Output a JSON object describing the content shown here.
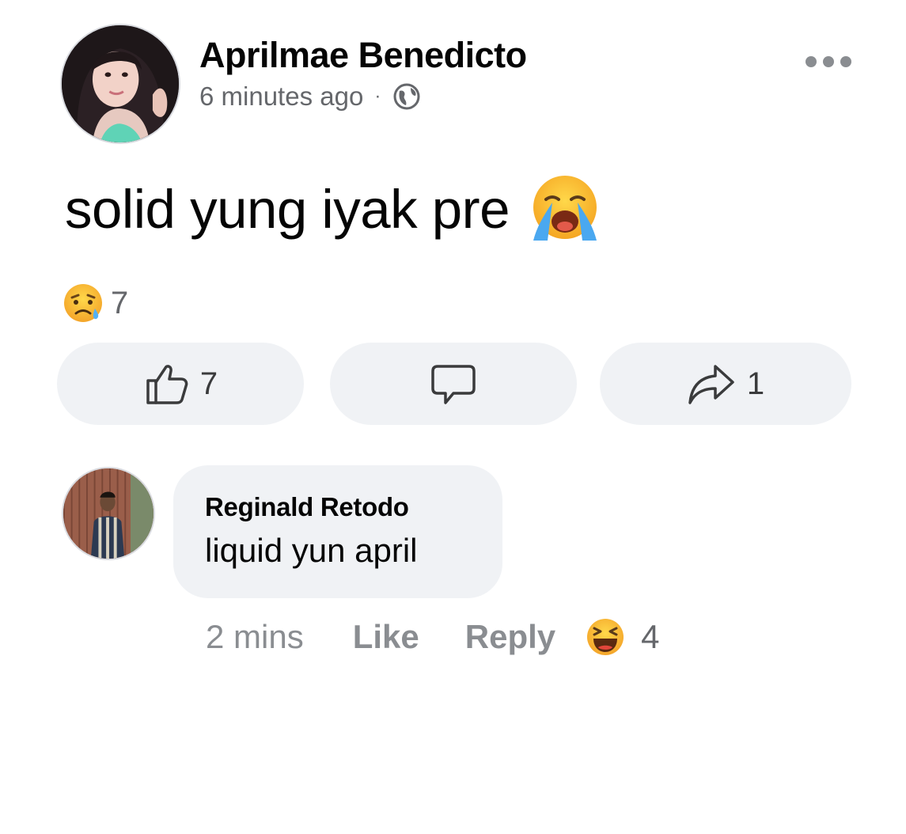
{
  "post": {
    "author": "Aprilmae Benedicto",
    "timestamp": "6 minutes ago",
    "separator": "·",
    "privacy_icon": "globe-icon",
    "text": "solid yung iyak pre",
    "text_emoji": "loudly-crying-face-emoji",
    "reactions": {
      "icon": "sad-but-relieved-face-emoji",
      "count": "7"
    }
  },
  "actions": {
    "like_count": "7",
    "share_count": "1"
  },
  "comment": {
    "author": "Reginald Retodo",
    "text": "liquid yun april",
    "time": "2 mins",
    "like_label": "Like",
    "reply_label": "Reply",
    "reaction_icon": "laughing-squinting-face-emoji",
    "reaction_count": "4"
  },
  "colors": {
    "button_bg": "#f0f2f5",
    "meta_text": "#65676b",
    "action_text": "#8a8d91",
    "primary_text": "#050505"
  }
}
